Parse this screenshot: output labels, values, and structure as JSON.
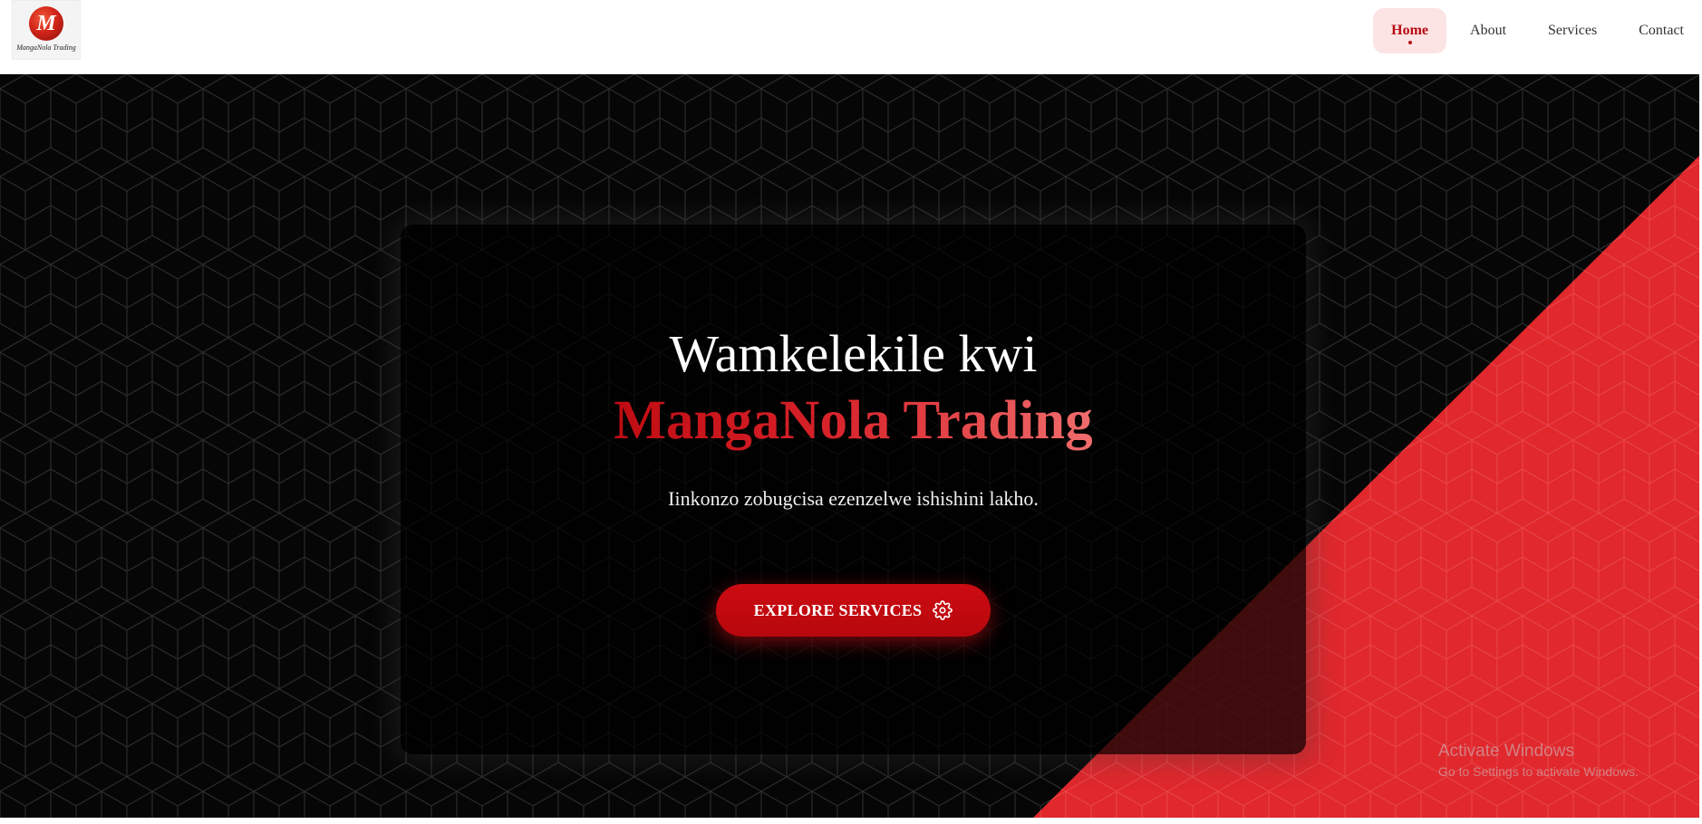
{
  "header": {
    "logo": {
      "monogram": "M",
      "wordmark": "MangaNola Trading"
    },
    "nav": [
      {
        "label": "Home",
        "active": true
      },
      {
        "label": "About",
        "active": false
      },
      {
        "label": "Services",
        "active": false
      },
      {
        "label": "Contact",
        "active": false
      }
    ]
  },
  "hero": {
    "title_line1": "Wamkelekile kwi",
    "title_line2": "MangaNola Trading",
    "subtitle": "Iinkonzo zobugcisa ezenzelwe ishishini lakho.",
    "cta_label": "EXPLORE SERVICES",
    "cta_icon": "gear-icon"
  },
  "watermark": {
    "title": "Activate Windows",
    "subtitle": "Go to Settings to activate Windows."
  },
  "colors": {
    "accent": "#c30b12",
    "accent_light": "#e3292f",
    "nav_active_bg": "#fce4e5",
    "hero_bg": "#060606"
  }
}
